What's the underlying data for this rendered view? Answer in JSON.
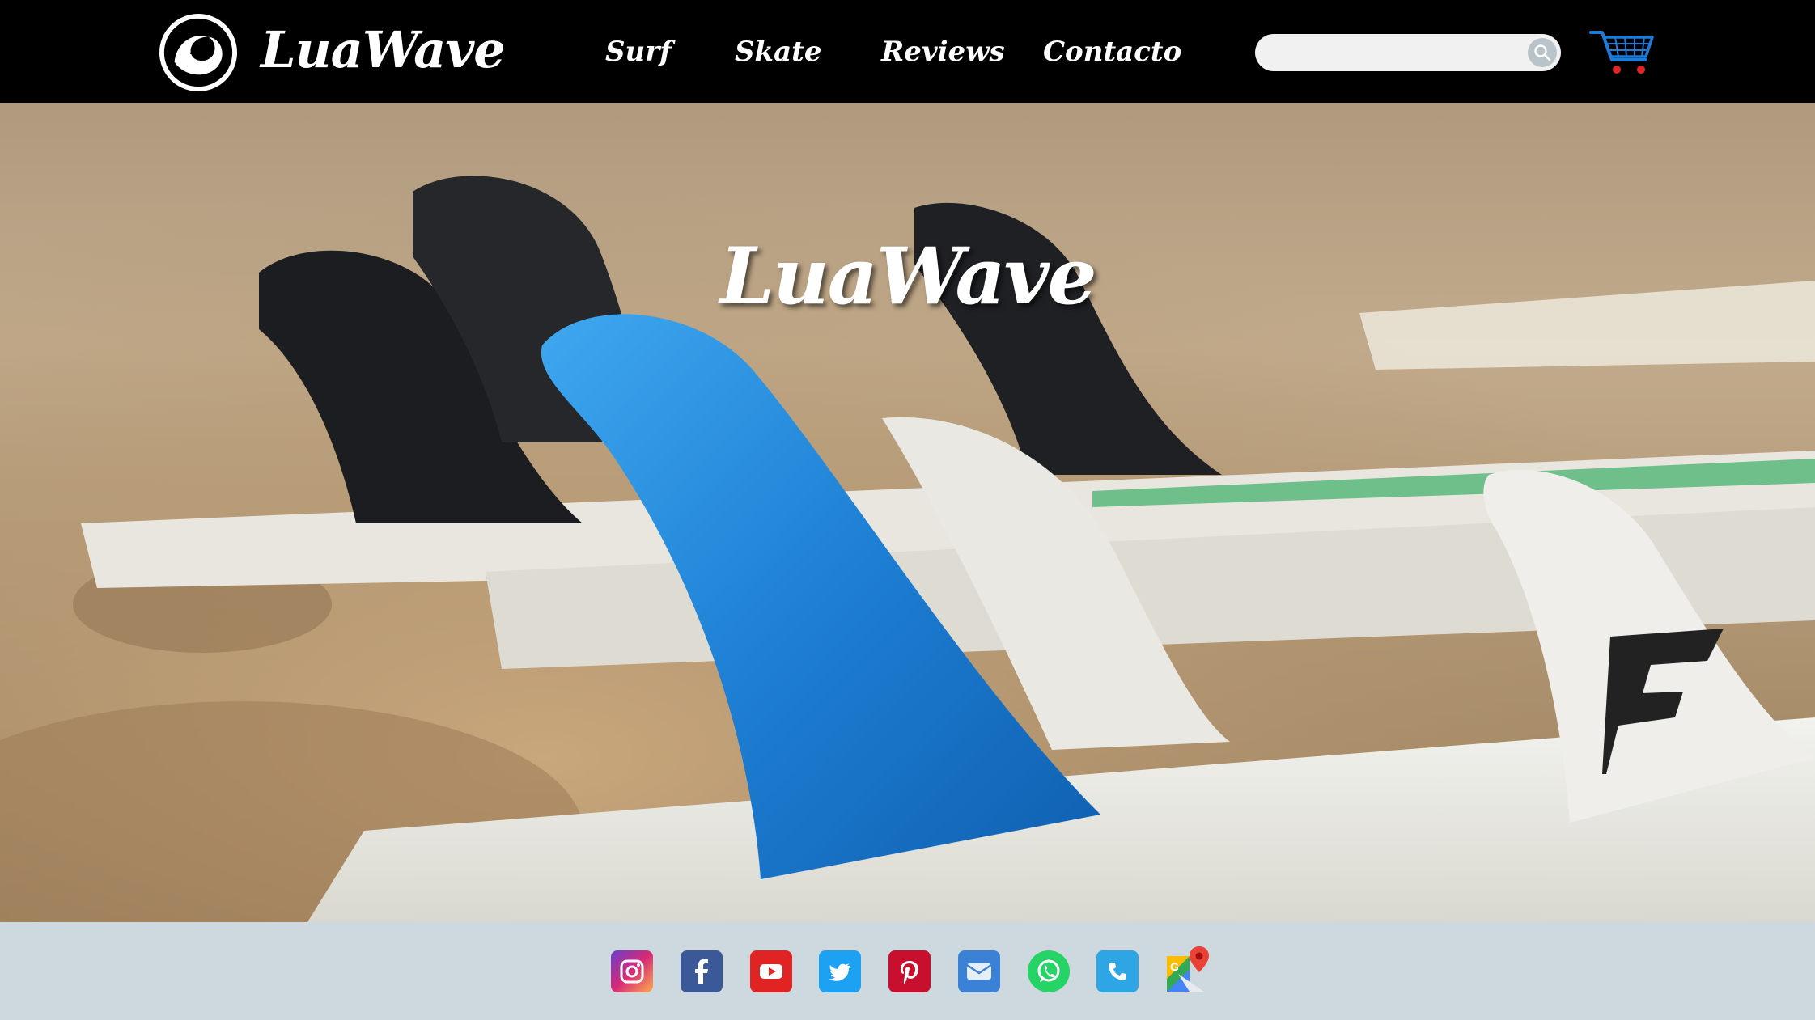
{
  "header": {
    "logo_text": "LuaWave",
    "nav": [
      "Surf",
      "Skate",
      "Reviews",
      "Contacto"
    ],
    "search_placeholder": "",
    "search_icon": "search-icon",
    "cart_icon": "shopping-cart-icon"
  },
  "hero": {
    "title": "LuaWave",
    "slides": 5,
    "active_slide": 1
  },
  "footer": {
    "social": [
      "instagram-icon",
      "facebook-icon",
      "youtube-icon",
      "twitter-icon",
      "pinterest-icon",
      "email-icon",
      "whatsapp-icon",
      "phone-icon",
      "google-maps-icon"
    ]
  },
  "colors": {
    "header_bg": "#000000",
    "footer_bg": "#cdd8df",
    "cart_blue": "#1e7bd8"
  }
}
